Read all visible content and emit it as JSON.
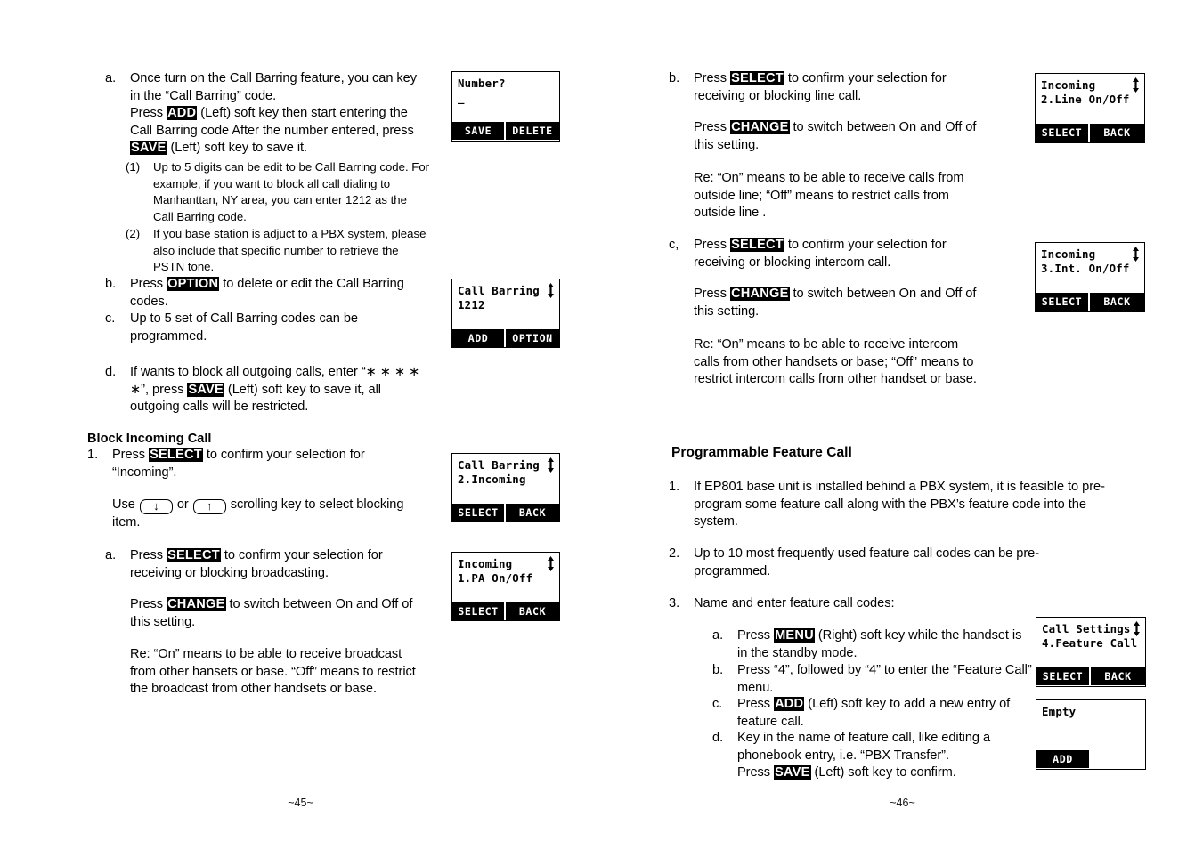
{
  "document": {
    "left_page_number": "~45~",
    "right_page_number": "~46~"
  },
  "left_page": {
    "items": [
      {
        "marker": "a.",
        "lines": [
          "Once turn on the Call Barring feature, you can key",
          "in the “Call Barring” code.",
          "Press ADD (Left) soft key then start entering the",
          "Call Barring code After the number entered, press",
          "SAVE (Left) soft key to save it."
        ],
        "keys": [
          "ADD",
          "SAVE"
        ]
      },
      {
        "marker": "(1)",
        "lines": [
          "Up to 5 digits can be edit to be Call Barring code. For",
          "example, if you want to block all call dialing to",
          "Manhanttan, NY area, you can enter 1212 as the",
          "Call Barring code."
        ]
      },
      {
        "marker": "(2)",
        "lines": [
          "If you base station is adjuct to a PBX system, please",
          "also include that specific number to retrieve the",
          "PSTN tone."
        ]
      },
      {
        "marker": "b.",
        "lines": [
          "Press OPTION to delete or edit the Call Barring",
          "codes."
        ],
        "keys": [
          "OPTION"
        ]
      },
      {
        "marker": "c.",
        "lines": [
          "Up to 5 set of Call Barring codes can be",
          "programmed."
        ]
      },
      {
        "marker": "d.",
        "lines": [
          "If wants to block all outgoing calls,  enter “∗ ∗ ∗ ∗",
          "∗”, press SAVE (Left) soft key to save it, all",
          "outgoing calls will be restricted."
        ],
        "keys": [
          "SAVE"
        ]
      }
    ],
    "section_heading": "Block Incoming Call",
    "step1": {
      "marker": "1.",
      "line1_a": "Press ",
      "line1_key": "SELECT",
      "line1_b": " to confirm your selection for",
      "line2": "“Incoming”.",
      "use_a": "Use ",
      "use_or": " or ",
      "use_b": "  scrolling key to select blocking",
      "use_c": "item.",
      "down_arrow": "↓",
      "up_arrow": "↑"
    },
    "step_a": {
      "marker": "a.",
      "p1_a": "Press ",
      "p1_key": "SELECT",
      "p1_b": " to confirm your selection for",
      "p1_c": "receiving or blocking broadcasting.",
      "p2_a": "Press ",
      "p2_key": "CHANGE",
      "p2_b": " to switch between On and Off of",
      "p2_c": "this setting.",
      "p3_l1": "Re: “On” means to be able to receive broadcast",
      "p3_l2": "from other hansets or base. “Off” means to restrict",
      "p3_l3": "the broadcast from other handsets or base."
    },
    "lcds": [
      {
        "name": "number-prompt",
        "line1": "Number?",
        "line2": "_",
        "arrow": false,
        "softkeys": [
          "SAVE",
          "DELETE"
        ]
      },
      {
        "name": "call-barring-code",
        "line1": "Call Barring",
        "line2": "1212",
        "arrow": true,
        "softkeys": [
          "ADD",
          "OPTION"
        ]
      },
      {
        "name": "call-barring-incoming",
        "line1": "Call Barring",
        "line2": "2.Incoming",
        "arrow": true,
        "softkeys": [
          "SELECT",
          "BACK"
        ]
      },
      {
        "name": "incoming-pa-onoff",
        "line1": "Incoming",
        "line2": "1.PA On/Off",
        "arrow": true,
        "softkeys": [
          "SELECT",
          "BACK"
        ]
      }
    ]
  },
  "right_page": {
    "step_b": {
      "marker": "b.",
      "p1_a": "Press ",
      "p1_key": "SELECT",
      "p1_b": " to confirm your selection for",
      "p1_c": "receiving or blocking line call.",
      "p2_a": "Press ",
      "p2_key": "CHANGE",
      "p2_b": " to switch between On and Off of",
      "p2_c": "this setting.",
      "p3_l1": "Re: “On” means to be able to receive calls from",
      "p3_l2": "outside line;  “Off” means to restrict calls from",
      "p3_l3": "outside line ."
    },
    "step_c": {
      "marker": "c,",
      "p1_a": "Press ",
      "p1_key": "SELECT",
      "p1_b": " to confirm your selection for",
      "p1_c": "receiving or blocking intercom call.",
      "p2_a": "Press ",
      "p2_key": "CHANGE",
      "p2_b": " to switch between On and Off of",
      "p2_c": "this setting.",
      "p3_l1": "Re: “On” means to be able to receive intercom",
      "p3_l2": "calls from other handsets or base;  “Off” means to",
      "p3_l3": "restrict intercom calls from other handset or base."
    },
    "section_heading": "Programmable Feature Call",
    "numbered": [
      {
        "marker": "1.",
        "lines": [
          "If EP801 base unit is installed behind a PBX system, it is feasible to pre-",
          "program some feature call along with the PBX’s feature code into the",
          "system."
        ]
      },
      {
        "marker": "2.",
        "lines": [
          "Up to 10 most frequently used feature call codes can be pre-",
          "programmed."
        ]
      },
      {
        "marker": "3.",
        "lines": [
          "Name and enter feature call codes:"
        ]
      }
    ],
    "sub_items": [
      {
        "marker": "a.",
        "pre": "Press ",
        "key": "MENU",
        "post": " (Right) soft key while the handset is",
        "line2": "in the standby mode."
      },
      {
        "marker": "b.",
        "pre": "Press “4”, followed by “4” to enter the “Feature Call”",
        "key": "",
        "post": "",
        "line2": "menu."
      },
      {
        "marker": "c.",
        "pre": "Press ",
        "key": "ADD",
        "post": " (Left) soft key to add a new entry of",
        "line2": "feature call."
      },
      {
        "marker": "d.",
        "pre": "Key in the name of feature call, like editing a",
        "key": "",
        "post": "",
        "line2": "phonebook entry, i.e. “PBX Transfer”."
      }
    ],
    "sub_item_d_extra": {
      "pre": "Press ",
      "key": "SAVE",
      "post": " (Left) soft key to confirm."
    },
    "lcds": [
      {
        "name": "incoming-line-onoff",
        "line1": "Incoming",
        "line2": "2.Line On/Off",
        "arrow": true,
        "softkeys": [
          "SELECT",
          "BACK"
        ]
      },
      {
        "name": "incoming-int-onoff",
        "line1": "Incoming",
        "line2": "3.Int. On/Off",
        "arrow": true,
        "softkeys": [
          "SELECT",
          "BACK"
        ]
      },
      {
        "name": "call-settings-feature-call",
        "line1": "Call Settings",
        "line2": "4.Feature Call",
        "arrow": true,
        "softkeys": [
          "SELECT",
          "BACK"
        ]
      },
      {
        "name": "feature-call-empty",
        "line1": "Empty",
        "line2": "",
        "arrow": false,
        "softkeys": [
          "ADD",
          ""
        ]
      }
    ]
  }
}
